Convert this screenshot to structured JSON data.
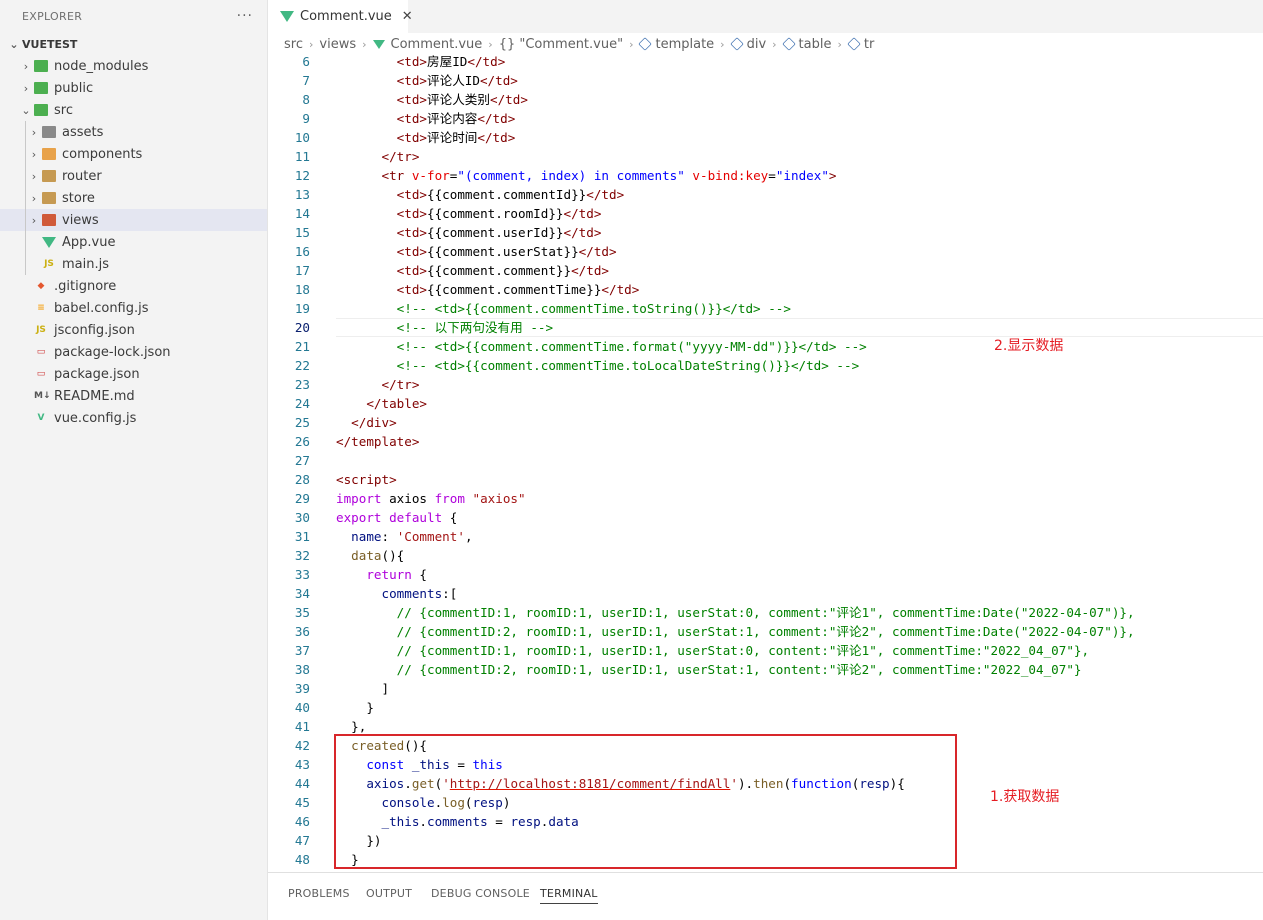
{
  "explorer": {
    "title": "EXPLORER",
    "more": "···",
    "root": "VUETEST",
    "items": [
      {
        "label": "node_modules",
        "type": "folder",
        "color": "green",
        "chev": "›"
      },
      {
        "label": "public",
        "type": "folder",
        "color": "green",
        "chev": "›"
      },
      {
        "label": "src",
        "type": "folder",
        "color": "green",
        "chev": "⌄"
      },
      {
        "label": "assets",
        "type": "folder",
        "color": "gray",
        "chev": "›"
      },
      {
        "label": "components",
        "type": "folder",
        "color": "orange",
        "chev": "›"
      },
      {
        "label": "router",
        "type": "folder",
        "color": "tan",
        "chev": "›"
      },
      {
        "label": "store",
        "type": "folder",
        "color": "tan",
        "chev": "›"
      },
      {
        "label": "views",
        "type": "folder",
        "color": "red",
        "chev": "›"
      },
      {
        "label": "App.vue",
        "type": "vue"
      },
      {
        "label": "main.js",
        "type": "js",
        "icon": "JS"
      },
      {
        "label": ".gitignore",
        "type": "git",
        "icon": "◆"
      },
      {
        "label": "babel.config.js",
        "type": "babel",
        "icon": "≡"
      },
      {
        "label": "jsconfig.json",
        "type": "json",
        "icon": "JS"
      },
      {
        "label": "package-lock.json",
        "type": "npm",
        "icon": "▭"
      },
      {
        "label": "package.json",
        "type": "npm",
        "icon": "▭"
      },
      {
        "label": "README.md",
        "type": "md",
        "icon": "M↓"
      },
      {
        "label": "vue.config.js",
        "type": "vue",
        "icon": "V"
      }
    ]
  },
  "tab": {
    "label": "Comment.vue",
    "close": "✕"
  },
  "breadcrumb": [
    "src",
    "views",
    "Comment.vue",
    "{} \"Comment.vue\"",
    "template",
    "div",
    "table",
    "tr"
  ],
  "editor": {
    "current_line": 20
  },
  "annotations": {
    "display": "2.显示数据",
    "fetch": "1.获取数据"
  },
  "panel_tabs": [
    "PROBLEMS",
    "OUTPUT",
    "DEBUG CONSOLE",
    "TERMINAL"
  ],
  "active_panel_tab": "TERMINAL"
}
